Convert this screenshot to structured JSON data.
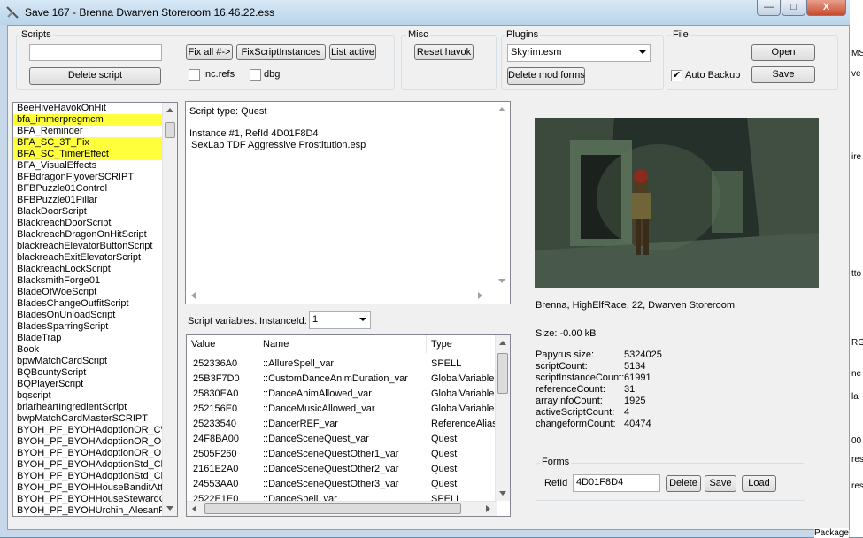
{
  "window": {
    "title": "Save 167 - Brenna  Dwarven Storeroom  16.46.22.ess",
    "buttons": {
      "minimize": "—",
      "maximize": "□",
      "close": "X"
    }
  },
  "scripts_group": {
    "label": "Scripts",
    "search_value": "",
    "delete_script": "Delete script",
    "fix_all": "Fix all #->",
    "fix_script_instances": "FixScriptInstances",
    "list_active": "List active",
    "inc_refs": "Inc.refs",
    "dbg": "dbg"
  },
  "misc_group": {
    "label": "Misc",
    "reset_havok": "Reset havok"
  },
  "plugins_group": {
    "label": "Plugins",
    "selected": "Skyrim.esm",
    "delete_mod_forms": "Delete mod forms"
  },
  "file_group": {
    "label": "File",
    "open": "Open",
    "auto_backup": "Auto Backup",
    "auto_backup_checked": "✔",
    "save": "Save"
  },
  "script_list": [
    {
      "label": "BeeHiveHavokOnHit",
      "highlighted": false
    },
    {
      "label": "bfa_immerpregmcm",
      "highlighted": true
    },
    {
      "label": "BFA_Reminder",
      "highlighted": false
    },
    {
      "label": "BFA_SC_3T_Fix",
      "highlighted": true
    },
    {
      "label": "BFA_SC_TimerEffect",
      "highlighted": true
    },
    {
      "label": "BFA_VisualEffects",
      "highlighted": false
    },
    {
      "label": "BFBdragonFlyoverSCRIPT",
      "highlighted": false
    },
    {
      "label": "BFBPuzzle01Control",
      "highlighted": false
    },
    {
      "label": "BFBPuzzle01Pillar",
      "highlighted": false
    },
    {
      "label": "BlackDoorScript",
      "highlighted": false
    },
    {
      "label": "BlackreachDoorScript",
      "highlighted": false
    },
    {
      "label": "BlackreachDragonOnHitScript",
      "highlighted": false
    },
    {
      "label": "blackreachElevatorButtonScript",
      "highlighted": false
    },
    {
      "label": "blackreachExitElevatorScript",
      "highlighted": false
    },
    {
      "label": "BlackreachLockScript",
      "highlighted": false
    },
    {
      "label": "BlacksmithForge01",
      "highlighted": false
    },
    {
      "label": "BladeOfWoeScript",
      "highlighted": false
    },
    {
      "label": "BladesChangeOutfitScript",
      "highlighted": false
    },
    {
      "label": "BladesOnUnloadScript",
      "highlighted": false
    },
    {
      "label": "BladesSparringScript",
      "highlighted": false
    },
    {
      "label": "BladeTrap",
      "highlighted": false
    },
    {
      "label": "Book",
      "highlighted": false
    },
    {
      "label": "bpwMatchCardScript",
      "highlighted": false
    },
    {
      "label": "BQBountyScript",
      "highlighted": false
    },
    {
      "label": "BQPlayerScript",
      "highlighted": false
    },
    {
      "label": "bqscript",
      "highlighted": false
    },
    {
      "label": "briarheartIngredientScript",
      "highlighted": false
    },
    {
      "label": "bwpMatchCardMasterSCRIPT",
      "highlighted": false
    },
    {
      "label": "BYOH_PF_BYOHAdoptionOR_CW",
      "highlighted": false
    },
    {
      "label": "BYOH_PF_BYOHAdoptionOR_Ord",
      "highlighted": false
    },
    {
      "label": "BYOH_PF_BYOHAdoptionOR_Ord",
      "highlighted": false
    },
    {
      "label": "BYOH_PF_BYOHAdoptionStd_Chil",
      "highlighted": false
    },
    {
      "label": "BYOH_PF_BYOHAdoptionStd_Chil",
      "highlighted": false
    },
    {
      "label": "BYOH_PF_BYOHHouseBanditAtta",
      "highlighted": false
    },
    {
      "label": "BYOH_PF_BYOHHouseStewardOf",
      "highlighted": false
    },
    {
      "label": "BYOH_PF_BYOHUrchin_AlesanRu",
      "highlighted": false
    }
  ],
  "details": {
    "script_type": "Script type: Quest",
    "instance": "Instance #1, RefId 4D01F8D4",
    "plugin": "SexLab TDF Aggressive Prostitution.esp"
  },
  "vars": {
    "label": "Script variables.",
    "instance_label": "InstanceId:",
    "instance_value": "1",
    "headers": {
      "value": "Value",
      "name": "Name",
      "type": "Type"
    },
    "rows": [
      {
        "value": "252336A0",
        "name": "::AllureSpell_var",
        "type": "SPELL"
      },
      {
        "value": "25B3F7D0",
        "name": "::CustomDanceAnimDuration_var",
        "type": "GlobalVariable[]"
      },
      {
        "value": "25830EA0",
        "name": "::DanceAnimAllowed_var",
        "type": "GlobalVariable[]"
      },
      {
        "value": "252156E0",
        "name": "::DanceMusicAllowed_var",
        "type": "GlobalVariable"
      },
      {
        "value": "25233540",
        "name": "::DancerREF_var",
        "type": "ReferenceAlias"
      },
      {
        "value": "24F8BA00",
        "name": "::DanceSceneQuest_var",
        "type": "Quest"
      },
      {
        "value": "2505F260",
        "name": "::DanceSceneQuestOther1_var",
        "type": "Quest"
      },
      {
        "value": "2161E2A0",
        "name": "::DanceSceneQuestOther2_var",
        "type": "Quest"
      },
      {
        "value": "24553AA0",
        "name": "::DanceSceneQuestOther3_var",
        "type": "Quest"
      },
      {
        "value": "2522E1E0",
        "name": "::DanceSpell_var",
        "type": "SPELL"
      }
    ]
  },
  "save_info": {
    "character": "Brenna, HighElfRace, 22, Dwarven Storeroom",
    "size": "Size: -0.00 kB",
    "stats": [
      {
        "key": "Papyrus size:",
        "value": "5324025"
      },
      {
        "key": "scriptCount:",
        "value": "5134"
      },
      {
        "key": "scriptInstanceCount:",
        "value": "61991"
      },
      {
        "key": "referenceCount:",
        "value": "31"
      },
      {
        "key": "arrayInfoCount:",
        "value": "1925"
      },
      {
        "key": "activeScriptCount:",
        "value": "4"
      },
      {
        "key": "changeformCount:",
        "value": "40474"
      }
    ]
  },
  "forms_group": {
    "label": "Forms",
    "refid_label": "RefId",
    "refid_value": "4D01F8D4",
    "delete": "Delete",
    "save": "Save",
    "load": "Load"
  },
  "background": {
    "snippets": [
      "MS",
      "ve",
      "ire",
      "tto",
      "RG",
      "ne",
      "la",
      "00",
      "res",
      "res"
    ],
    "package": "Package"
  }
}
